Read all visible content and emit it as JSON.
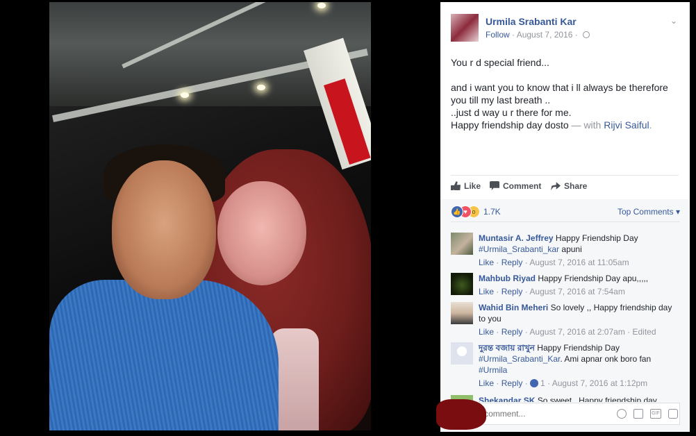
{
  "post": {
    "author": "Urmila Srabanti Kar",
    "follow": "Follow",
    "dot": " · ",
    "date": "August 7, 2016",
    "text": "You r d special friend...\n\nand i want you to know that i ll always be therefore you till my last breath ..\n..just d way u r there for me.\nHappy friendship day dosto",
    "with": " — with ",
    "tagged": "Rijvi Saiful",
    "tagged_suffix": "."
  },
  "actions": {
    "like": "Like",
    "comment": "Comment",
    "share": "Share"
  },
  "reactions": {
    "count": "1.7K",
    "sort": "Top Comments ▾",
    "icons": [
      "like-icon",
      "love-icon",
      "wow-icon"
    ]
  },
  "comments": [
    {
      "name": "Muntasir A. Jeffrey",
      "text_pre": " Happy Friendship Day ",
      "tag": "#Urmila_Srabanti_kar",
      "text_post": " apuni",
      "like": "Like",
      "reply": "Reply",
      "time": "August 7, 2016 at 11:05am"
    },
    {
      "name": "Mahbub Riyad",
      "text_pre": " Happy Friendship Day apu,,,,,",
      "like": "Like",
      "reply": "Reply",
      "time": "August 7, 2016 at 7:54am"
    },
    {
      "name": "Wahid Bin Meheri",
      "text_pre": " So lovely ,, Happy friendship day to you",
      "like": "Like",
      "reply": "Reply",
      "time": "August 7, 2016 at 2:07am",
      "edited": "Edited"
    },
    {
      "name": "দুরন্ত বজায় রাখুন",
      "text_pre": " Happy Friendship Day ",
      "tag": "#Urmila_Srabanti_Kar",
      "text_mid": ". Ami apnar onk boro fan ",
      "tag2": "#Urmila",
      "like": "Like",
      "reply": "Reply",
      "likes": "1",
      "time": "August 7, 2016 at 1:12pm"
    },
    {
      "name": "Shekandar SK",
      "text_pre": " So sweet.. Happy friendship day"
    }
  ],
  "composer": {
    "placeholder": "Write a comment..."
  },
  "ui": {
    "chevron": "⌄",
    "sep": " · "
  },
  "colors": {
    "link": "#365899",
    "meta": "#90949c",
    "panel_bg": "#ffffff",
    "comments_bg": "#f6f7f9"
  }
}
